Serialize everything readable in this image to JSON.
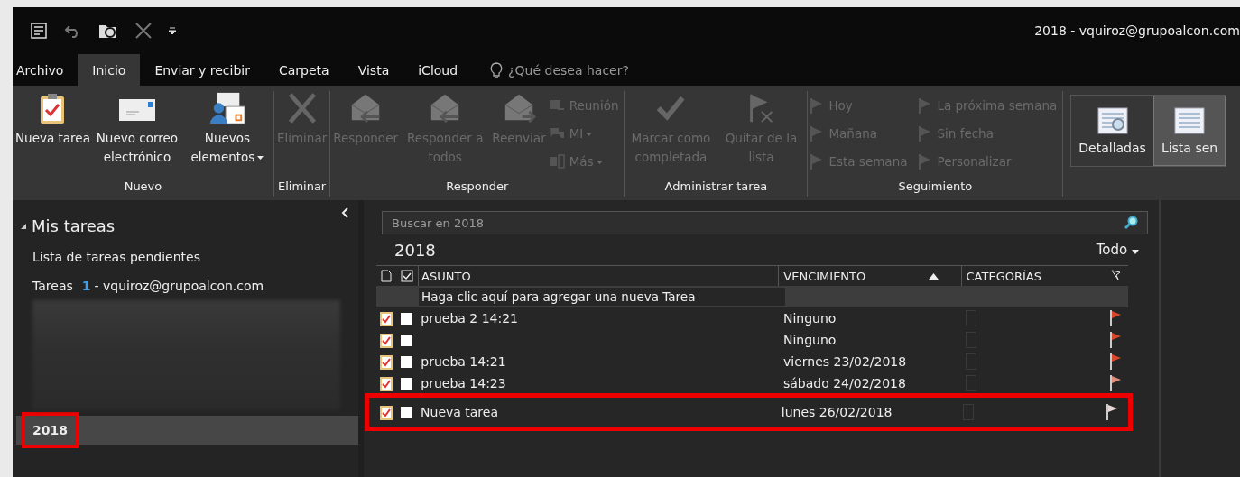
{
  "window": {
    "title": "2018 - vquiroz@grupoalcon.com"
  },
  "tabs": [
    {
      "label": "Archivo",
      "selected": false
    },
    {
      "label": "Inicio",
      "selected": true
    },
    {
      "label": "Enviar y recibir",
      "selected": false
    },
    {
      "label": "Carpeta",
      "selected": false
    },
    {
      "label": "Vista",
      "selected": false
    },
    {
      "label": "iCloud",
      "selected": false
    }
  ],
  "tell_me": {
    "placeholder": "¿Qué desea hacer?"
  },
  "ribbon": {
    "groups": [
      {
        "label": "Nuevo",
        "buttons": [
          {
            "label": "Nueva tarea",
            "kind": "task",
            "disabled": false,
            "caret": false
          },
          {
            "label": "Nuevo correo electrónico",
            "kind": "mail",
            "disabled": false,
            "caret": false
          },
          {
            "label": "Nuevos elementos",
            "kind": "items",
            "disabled": false,
            "caret": true
          }
        ]
      },
      {
        "label": "Eliminar",
        "buttons": [
          {
            "label": "Eliminar",
            "kind": "delete",
            "disabled": true,
            "caret": false
          }
        ]
      },
      {
        "label": "Responder",
        "buttons": [
          {
            "label": "Responder",
            "kind": "reply",
            "disabled": true,
            "caret": false
          },
          {
            "label": "Responder a todos",
            "kind": "replyall",
            "disabled": true,
            "caret": false
          },
          {
            "label": "Reenviar",
            "kind": "forward",
            "disabled": true,
            "caret": false
          }
        ],
        "small_buttons": [
          {
            "label": "Reunión",
            "kind": "meeting",
            "disabled": true,
            "caret": false
          },
          {
            "label": "MI",
            "kind": "chat",
            "disabled": true,
            "caret": true
          },
          {
            "label": "Más",
            "kind": "more",
            "disabled": true,
            "caret": true
          }
        ]
      },
      {
        "label": "Administrar tarea",
        "buttons": [
          {
            "label": "Marcar como completada",
            "kind": "check",
            "disabled": true,
            "caret": false
          },
          {
            "label": "Quitar de la lista",
            "kind": "unflag",
            "disabled": true,
            "caret": false
          }
        ]
      },
      {
        "label": "Seguimiento",
        "small_buttons": [
          {
            "label": "Hoy",
            "kind": "flag",
            "disabled": true,
            "caret": false
          },
          {
            "label": "Mañana",
            "kind": "flag",
            "disabled": true,
            "caret": false
          },
          {
            "label": "Esta semana",
            "kind": "flag",
            "disabled": true,
            "caret": false
          },
          {
            "label": "La próxima semana",
            "kind": "flag",
            "disabled": true,
            "caret": false
          },
          {
            "label": "Sin fecha",
            "kind": "flag",
            "disabled": true,
            "caret": false
          },
          {
            "label": "Personalizar",
            "kind": "flag",
            "disabled": true,
            "caret": false
          }
        ]
      }
    ],
    "views": [
      {
        "label": "Detalladas",
        "selected": false
      },
      {
        "label": "Lista sen",
        "selected": true
      }
    ]
  },
  "sidebar": {
    "header": {
      "label": "Mis tareas",
      "expanded": true
    },
    "items": [
      {
        "label": "Lista de tareas pendientes",
        "selected": false,
        "highlighted": false
      },
      {
        "label": "Tareas",
        "count": "1",
        "account": "- vquiroz@grupoalcon.com",
        "selected": false,
        "highlighted": false
      },
      {
        "label": "2018",
        "selected": true,
        "highlighted": true
      }
    ]
  },
  "task_list": {
    "search": {
      "placeholder": "Buscar en 2018"
    },
    "folder_title": "2018",
    "filter": "Todo",
    "columns": [
      {
        "label": "ASUNTO",
        "sorted": false
      },
      {
        "label": "VENCIMIENTO",
        "sorted": true
      },
      {
        "label": "CATEGORÍAS",
        "sorted": false
      }
    ],
    "new_row": {
      "placeholder": "Haga clic aquí para agregar una nueva Tarea"
    },
    "rows": [
      {
        "subject": "prueba  2 14:21",
        "due": "Ninguno",
        "checked": false,
        "color": "#d9482a",
        "highlighted": false
      },
      {
        "subject": "",
        "due": "Ninguno",
        "checked": false,
        "color": "#d9482a",
        "highlighted": false
      },
      {
        "subject": "prueba 14:21",
        "due": "viernes 23/02/2018",
        "checked": false,
        "color": "#d9482a",
        "highlighted": false
      },
      {
        "subject": "prueba 14:23",
        "due": "sábado 24/02/2018",
        "checked": false,
        "color": "#e08c7a",
        "highlighted": false
      },
      {
        "subject": "Nueva tarea",
        "due": "lunes 26/02/2018",
        "checked": false,
        "color": "#e8d8d8",
        "highlighted": true
      }
    ]
  }
}
